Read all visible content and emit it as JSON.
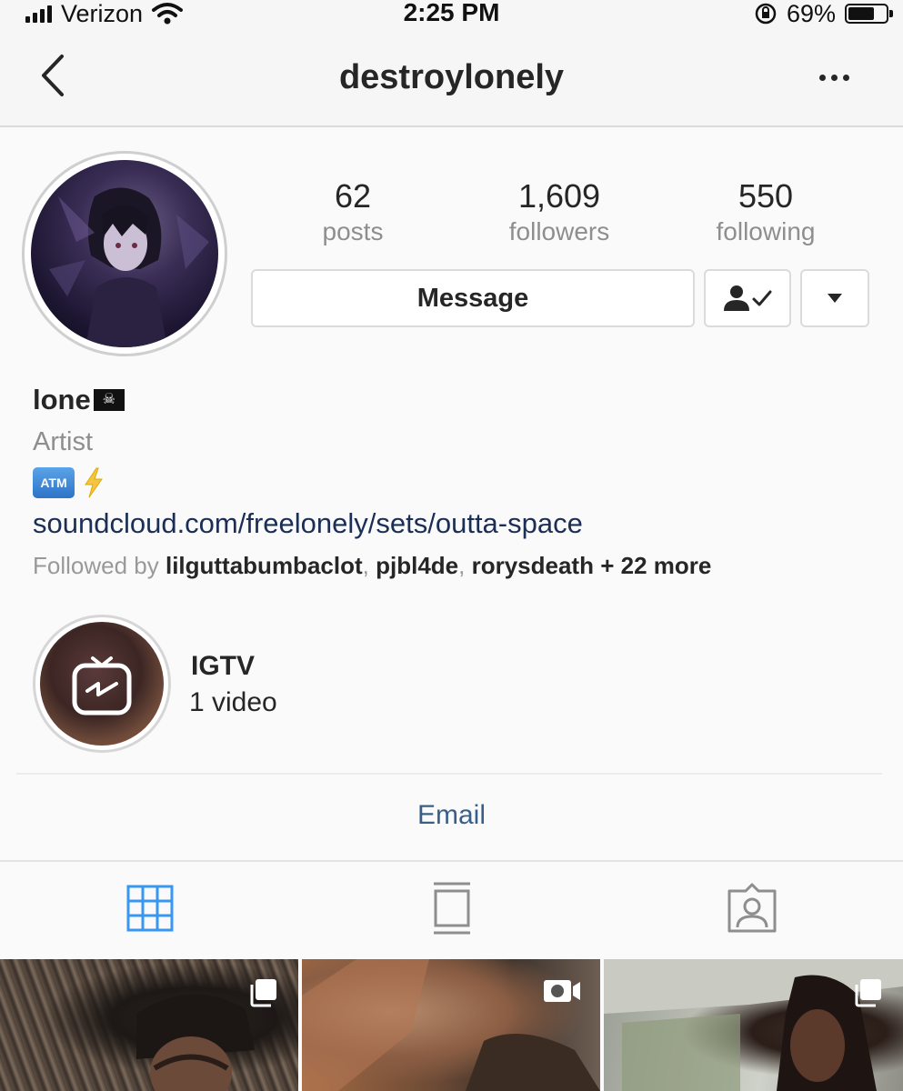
{
  "status_bar": {
    "carrier": "Verizon",
    "time": "2:25 PM",
    "battery_text": "69%",
    "battery_level": 0.69
  },
  "nav": {
    "title": "destroylonely"
  },
  "stats": [
    {
      "value": "62",
      "label": "posts"
    },
    {
      "value": "1,609",
      "label": "followers"
    },
    {
      "value": "550",
      "label": "following"
    }
  ],
  "actions": {
    "message_label": "Message"
  },
  "bio": {
    "name": "lone",
    "category": "Artist",
    "atm_label": "ATM",
    "link": "soundcloud.com/freelonely/sets/outta-space",
    "followed_by_prefix": "Followed by",
    "followed_by_users": [
      "lilguttabumbaclot",
      "pjbl4de",
      "rorysdeath"
    ],
    "followed_by_more": "+ 22 more"
  },
  "igtv": {
    "title": "IGTV",
    "count": "1 video"
  },
  "contact": {
    "email_label": "Email"
  },
  "tabs": [
    {
      "name": "grid",
      "active": true
    },
    {
      "name": "feed",
      "active": false
    },
    {
      "name": "tagged",
      "active": false
    }
  ],
  "posts": [
    {
      "type": "carousel"
    },
    {
      "type": "video"
    },
    {
      "type": "carousel"
    }
  ],
  "colors": {
    "accent_blue": "#3897f0",
    "link": "#385f8a",
    "muted": "#8e8e8e"
  }
}
